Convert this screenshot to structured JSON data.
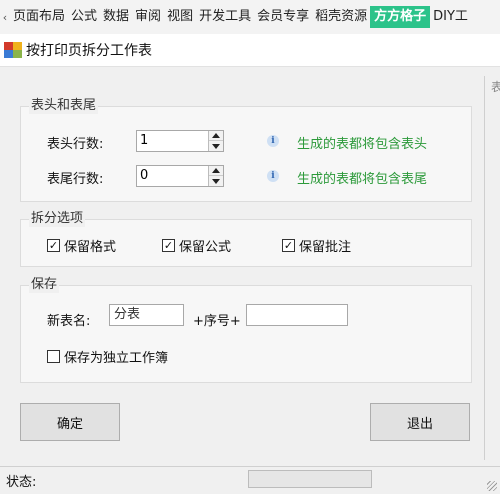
{
  "ribbon": {
    "tabs": [
      {
        "label": "页面布局",
        "active": false
      },
      {
        "label": "公式",
        "active": false
      },
      {
        "label": "数据",
        "active": false
      },
      {
        "label": "审阅",
        "active": false
      },
      {
        "label": "视图",
        "active": false
      },
      {
        "label": "开发工具",
        "active": false
      },
      {
        "label": "会员专享",
        "active": false
      },
      {
        "label": "稻壳资源",
        "active": false
      },
      {
        "label": "方方格子",
        "active": true
      },
      {
        "label": "DIY工",
        "active": false
      }
    ],
    "active_color": "#2cc38a"
  },
  "dialog": {
    "title": "按打印页拆分工作表",
    "side_panel_label": "表"
  },
  "header_footer": {
    "title": "表头和表尾",
    "header_rows_label": "表头行数:",
    "header_rows_value": "1",
    "header_hint": "生成的表都将包含表头",
    "footer_rows_label": "表尾行数:",
    "footer_rows_value": "0",
    "footer_hint": "生成的表都将包含表尾",
    "hint_color": "#2c9a3a"
  },
  "split_options": {
    "title": "拆分选项",
    "keep_format": {
      "label": "保留格式",
      "checked": true
    },
    "keep_formula": {
      "label": "保留公式",
      "checked": true
    },
    "keep_comment": {
      "label": "保留批注",
      "checked": true
    }
  },
  "save": {
    "title": "保存",
    "new_name_label": "新表名:",
    "new_name_value": "分表",
    "seq_label": "+序号+",
    "suffix_value": "",
    "save_as_workbook": {
      "label": "保存为独立工作簿",
      "checked": false
    }
  },
  "buttons": {
    "ok": "确定",
    "exit": "退出"
  },
  "status": {
    "label": "状态:",
    "progress": 0
  },
  "icons": {
    "info": "i",
    "check": "✓",
    "scroll_left": "‹"
  }
}
